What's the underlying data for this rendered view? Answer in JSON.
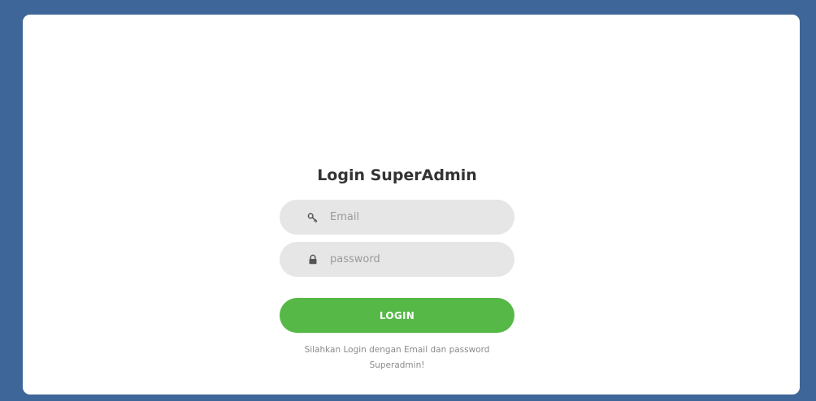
{
  "login": {
    "title": "Login SuperAdmin",
    "email": {
      "placeholder": "Email",
      "value": "",
      "icon": "key-icon"
    },
    "password": {
      "placeholder": "password",
      "value": "",
      "icon": "lock-icon"
    },
    "submit_label": "LOGIN",
    "hint_line1": "Silahkan Login dengan Email dan password",
    "hint_line2": "Superadmin!"
  },
  "colors": {
    "background": "#3f6699",
    "card": "#ffffff",
    "input_bg": "#e6e6e6",
    "button": "#56b847",
    "title": "#333333",
    "hint": "#8a8a8a"
  }
}
